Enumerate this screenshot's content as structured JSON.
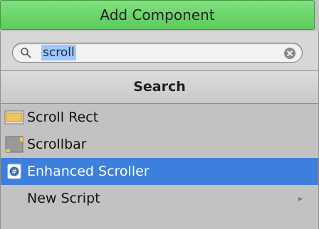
{
  "add_component": {
    "label": "Add Component"
  },
  "search": {
    "value": "scroll",
    "placeholder": ""
  },
  "section": {
    "title": "Search"
  },
  "items": [
    {
      "label": "Scroll Rect",
      "icon": "scroll-rect-icon",
      "selected": false
    },
    {
      "label": "Scrollbar",
      "icon": "scrollbar-icon",
      "selected": false
    },
    {
      "label": "Enhanced Scroller",
      "icon": "csharp-script-icon",
      "selected": true
    },
    {
      "label": "New Script",
      "icon": "none",
      "selected": false,
      "submenu_arrow": "▸"
    }
  ],
  "colors": {
    "add_button": "#5ccb5c",
    "selection": "#3d7fdc",
    "panel": "#c2c2c2"
  }
}
